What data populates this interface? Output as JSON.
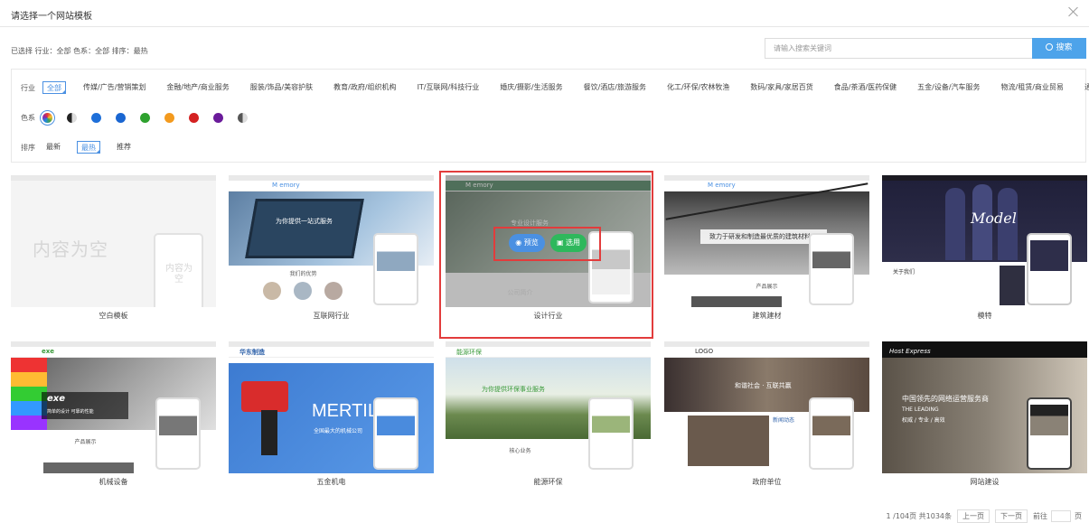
{
  "dialog": {
    "title": "请选择一个网站模板"
  },
  "selected_summary": {
    "text": "已选择 行业：全部  色系：全部  排序：最热"
  },
  "search": {
    "placeholder": "请输入搜索关键词",
    "button_label": "搜索"
  },
  "filters": {
    "industry": {
      "label": "行业",
      "items": [
        "全部",
        "传媒/广告/营销策划",
        "金融/地产/商业服务",
        "服装/饰品/美容护肤",
        "教育/政府/组织机构",
        "IT/互联网/科技行业",
        "婚庆/摄影/生活服务",
        "餐饮/酒店/旅游服务",
        "化工/环保/农林牧渔",
        "数码/家具/家居百货",
        "食品/茶酒/医药保健",
        "五金/设备/汽车服务",
        "物流/租赁/商业贸易",
        "通用行业"
      ],
      "active": "全部"
    },
    "color": {
      "label": "色系",
      "swatches": [
        "all",
        "#222222",
        "#1e6fd9",
        "#1a66d1",
        "#2ea12e",
        "#f39a1e",
        "#d42121",
        "#6a1b9a",
        "#999999"
      ]
    },
    "sort": {
      "label": "排序",
      "items": [
        "最新",
        "最热",
        "推荐"
      ],
      "active": "最热"
    }
  },
  "templates": [
    {
      "caption": "空白模板",
      "kind": "blank",
      "empty_text": "内容为空",
      "empty_text_small": "内容为空"
    },
    {
      "caption": "互联网行业",
      "kind": "internet",
      "logo": "M emory",
      "hero_text": "为你提供一站式服务",
      "section_title": "我们的优势"
    },
    {
      "caption": "设计行业",
      "kind": "design",
      "logo": "M emory",
      "hero_text": "专业设计服务",
      "section_title": "公司简介"
    },
    {
      "caption": "建筑建材",
      "kind": "building",
      "logo": "M emory",
      "hero_text": "致力于研发和制造最优质的建筑材料",
      "section_title": "产品展示"
    },
    {
      "caption": "模特",
      "kind": "model",
      "hero_text": "Model",
      "section_title": "关于我们"
    },
    {
      "caption": "机械设备",
      "kind": "machine",
      "logo": "exe",
      "hero_text": "exe",
      "hero_sub": "简单的设计 可靠的性能",
      "section_title": "产品展示"
    },
    {
      "caption": "五金机电",
      "kind": "hardware",
      "logo": "华东制造",
      "hero_text": "MERTIL",
      "hero_sub": "全国最大的机械公司"
    },
    {
      "caption": "能源环保",
      "kind": "energy",
      "logo": "能源环保",
      "hero_text": "为你提供环保事业服务",
      "section_title": "核心业务"
    },
    {
      "caption": "政府单位",
      "kind": "gov",
      "logo": "LOGO",
      "hero_text": "和谐社会 · 互联共赢",
      "section_title": "新闻动态"
    },
    {
      "caption": "网站建设",
      "kind": "website",
      "logo": "Host Express",
      "hero_text": "中国领先的网络运营服务商",
      "hero_sub": "THE LEADING",
      "hero_sub2": "权威 / 专业 / 高效"
    }
  ],
  "hover_actions": {
    "preview_label": "预览",
    "use_label": "选用"
  },
  "pagination": {
    "info": "1 /104页  共1034条",
    "prev_label": "上一页",
    "next_label": "下一页",
    "goto_label": "前往",
    "page_suffix": "页"
  }
}
